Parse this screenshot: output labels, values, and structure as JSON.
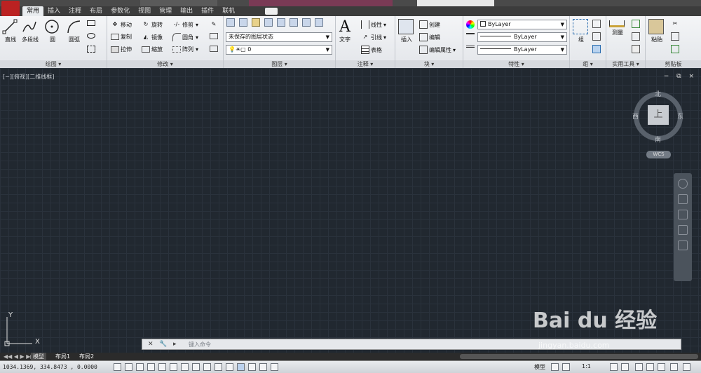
{
  "ribbon_tabs": [
    "常用",
    "插入",
    "注释",
    "布局",
    "参数化",
    "视图",
    "管理",
    "输出",
    "插件",
    "联机"
  ],
  "active_tab": "常用",
  "draw": {
    "line": "直线",
    "polyline": "多段线",
    "circle": "圆",
    "arc": "圆弧",
    "title": "绘图 ▾"
  },
  "modify": {
    "move": "移动",
    "rotate": "旋转",
    "trim": "修剪",
    "copy": "复制",
    "mirror": "镜像",
    "fillet": "圆角",
    "stretch": "拉伸",
    "scale": "缩放",
    "array": "阵列",
    "title": "修改 ▾"
  },
  "layers": {
    "state": "未保存的图层状态",
    "current": "0",
    "title": "图层 ▾"
  },
  "annotation": {
    "text": "文字",
    "linear": "线性",
    "leader": "引线",
    "table": "表格",
    "title": "注释 ▾"
  },
  "block": {
    "insert": "插入",
    "create": "创建",
    "edit": "编辑",
    "edit_attr": "编辑属性",
    "title": "块 ▾"
  },
  "properties": {
    "color": "ByLayer",
    "linetype": "ByLayer",
    "lineweight": "ByLayer",
    "title": "特性 ▾"
  },
  "groups": {
    "group": "组",
    "title": "组 ▾"
  },
  "utilities": {
    "measure": "测量",
    "title": "实用工具 ▾"
  },
  "clipboard": {
    "paste": "粘贴",
    "title": "剪贴板"
  },
  "viewport": {
    "label": "[−][俯视][二维线框]",
    "controls": "− ⧉ ×"
  },
  "viewcube": {
    "face": "上",
    "north": "北",
    "south": "南",
    "east": "东",
    "west": "西",
    "wcs": "WCS"
  },
  "ucs": {
    "x": "X",
    "y": "Y"
  },
  "command": {
    "placeholder": "键入命令"
  },
  "layout_tabs": [
    "模型",
    "布局1",
    "布局2"
  ],
  "status": {
    "coords": "1034.1369, 334.8473 , 0.0000",
    "model": "模型",
    "scale": "1:1"
  },
  "watermark": {
    "brand": "Bai du 经验",
    "url": "jingyan.baidu.com"
  },
  "colors": {
    "canvas": "#212830",
    "grid": "#2a323c",
    "ribbon": "#e9ecef"
  }
}
